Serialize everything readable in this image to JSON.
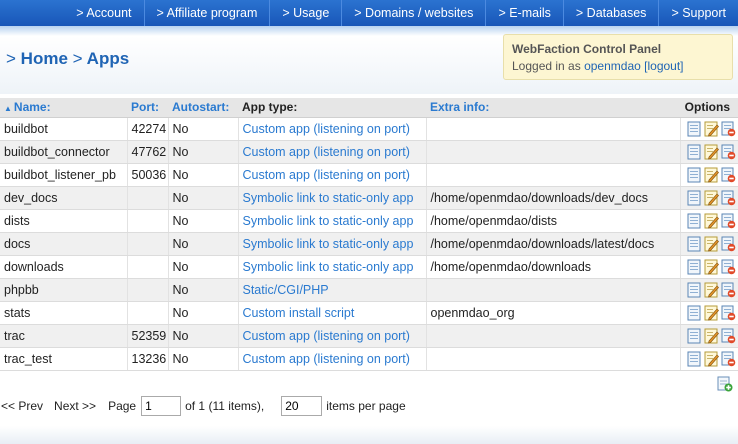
{
  "nav": [
    {
      "label": "> Account"
    },
    {
      "label": "> Affiliate program"
    },
    {
      "label": "> Usage"
    },
    {
      "label": "> Domains / websites"
    },
    {
      "label": "> E-mails"
    },
    {
      "label": "> Databases"
    },
    {
      "label": "> Support"
    }
  ],
  "breadcrumb": {
    "sep1": ">",
    "home": "Home",
    "sep2": ">",
    "current": "Apps"
  },
  "panel": {
    "title": "WebFaction Control Panel",
    "logged_in_prefix": "Logged in as",
    "user": "openmdao",
    "logout": "[logout]"
  },
  "table": {
    "headers": {
      "name": "Name:",
      "port": "Port:",
      "autostart": "Autostart:",
      "app_type": "App type:",
      "extra": "Extra info:",
      "options": "Options"
    },
    "rows": [
      {
        "name": "buildbot",
        "port": "42274",
        "autostart": "No",
        "app_type": "Custom app (listening on port)",
        "extra": ""
      },
      {
        "name": "buildbot_connector",
        "port": "47762",
        "autostart": "No",
        "app_type": "Custom app (listening on port)",
        "extra": ""
      },
      {
        "name": "buildbot_listener_pb",
        "port": "50036",
        "autostart": "No",
        "app_type": "Custom app (listening on port)",
        "extra": ""
      },
      {
        "name": "dev_docs",
        "port": "",
        "autostart": "No",
        "app_type": "Symbolic link to static-only app",
        "extra": "/home/openmdao/downloads/dev_docs"
      },
      {
        "name": "dists",
        "port": "",
        "autostart": "No",
        "app_type": "Symbolic link to static-only app",
        "extra": "/home/openmdao/dists"
      },
      {
        "name": "docs",
        "port": "",
        "autostart": "No",
        "app_type": "Symbolic link to static-only app",
        "extra": "/home/openmdao/downloads/latest/docs"
      },
      {
        "name": "downloads",
        "port": "",
        "autostart": "No",
        "app_type": "Symbolic link to static-only app",
        "extra": "/home/openmdao/downloads"
      },
      {
        "name": "phpbb",
        "port": "",
        "autostart": "No",
        "app_type": "Static/CGI/PHP",
        "extra": ""
      },
      {
        "name": "stats",
        "port": "",
        "autostart": "No",
        "app_type": "Custom install script",
        "extra": "openmdao_org"
      },
      {
        "name": "trac",
        "port": "52359",
        "autostart": "No",
        "app_type": "Custom app (listening on port)",
        "extra": ""
      },
      {
        "name": "trac_test",
        "port": "13236",
        "autostart": "No",
        "app_type": "Custom app (listening on port)",
        "extra": ""
      }
    ]
  },
  "pager": {
    "prev": "<< Prev",
    "next": "Next >>",
    "page_label": "Page",
    "page_value": "1",
    "of_text": "of 1 (11 items),",
    "per_page_value": "20",
    "per_page_label": "items per page"
  },
  "colors": {
    "nav_bg": "#1f5fc0",
    "link": "#2a7ad0",
    "panel_bg": "#fdf6d2"
  },
  "icons": {
    "row_actions": [
      "view-icon",
      "edit-icon",
      "delete-icon"
    ],
    "add": "add-app-icon"
  }
}
